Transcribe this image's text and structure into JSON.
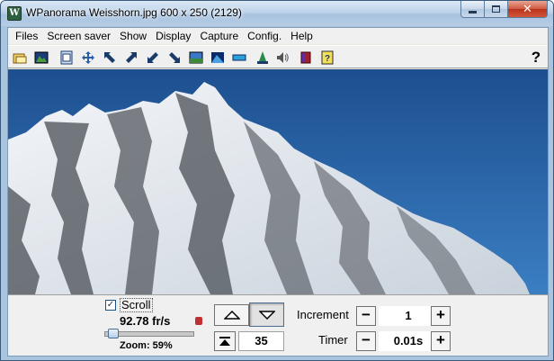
{
  "window": {
    "title": "WPanorama  Weisshorn.jpg   600 x 250 (2129)",
    "app_icon": "w-panorama-icon"
  },
  "menu": {
    "items": [
      "Files",
      "Screen saver",
      "Show",
      "Display",
      "Capture",
      "Config.",
      "Help"
    ]
  },
  "toolbar": {
    "icons": [
      "open-file-icon",
      "picture-icon",
      "fit-window-icon",
      "move-icon",
      "arrow-nw-icon",
      "arrow-ne-icon",
      "arrow-sw-icon",
      "arrow-se-icon",
      "display-mode-icon",
      "landscape-icon",
      "horizon-icon",
      "person-panorama-icon",
      "sound-icon",
      "book-icon",
      "help-index-icon"
    ],
    "help_label": "?"
  },
  "image": {
    "name": "Weisshorn.jpg",
    "sky_color": "#1e5a9e",
    "snow_color": "#eef1f5",
    "rock_color": "#4a4f56"
  },
  "controls": {
    "scroll_checked": true,
    "scroll_label": "Scroll",
    "fps": "92.78 fr/s",
    "zoom_label": "Zoom: 59%",
    "zoom_percent": 59,
    "position_value": "35",
    "increment_label": "Increment",
    "increment_value": "1",
    "timer_label": "Timer",
    "timer_value": "0.01s",
    "minus": "−",
    "plus": "+"
  }
}
